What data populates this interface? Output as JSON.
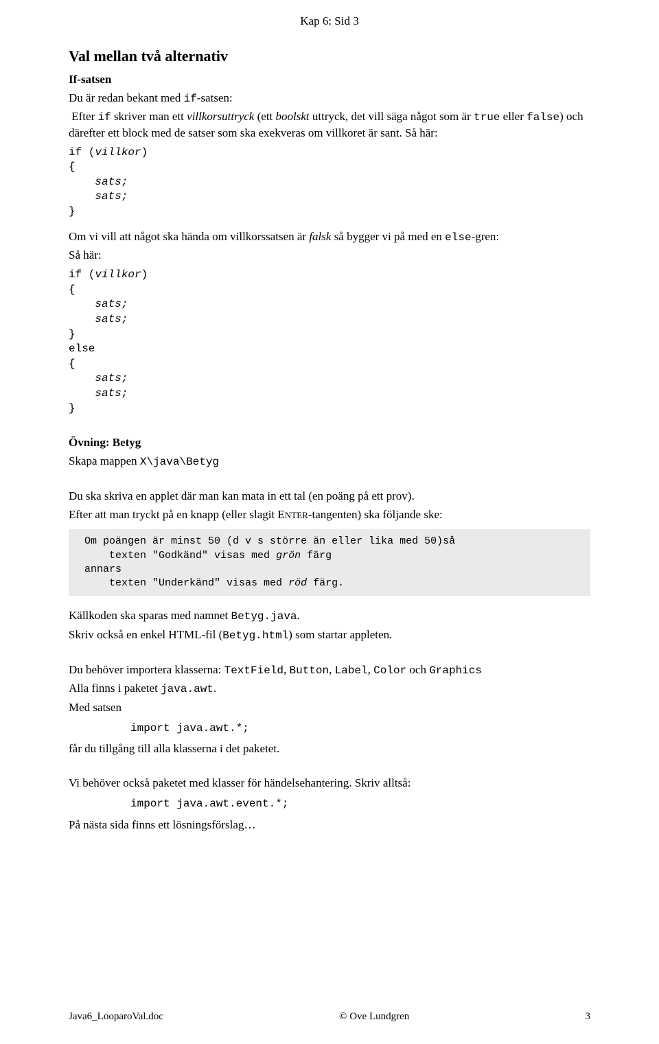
{
  "header": "Kap 6:  Sid 3",
  "title": "Val mellan två alternativ",
  "sub1": "If-satsen",
  "intro": {
    "pre_if": "Du  är redan bekant med ",
    "if_word": "if",
    "post_if": "-satsen:",
    "line2a": " Efter ",
    "line2_if": "if",
    "line2b": " skriver man ett ",
    "villkorsuttryck": "villkorsuttryck",
    "line2c": " (ett ",
    "boolskt": "boolskt",
    "line2d": " uttryck, det vill säga något som är ",
    "true": "true",
    "line2e": " eller ",
    "false": "false",
    "line2f": ") och därefter ett block med de satser som ska exekveras om villkoret är sant. Så här:"
  },
  "code1": "if (villkor)\n{\n    sats;\n    sats;\n}",
  "between": {
    "a": "Om vi vill att något ska hända om villkorssatsen är ",
    "falsk": "falsk",
    "b": " så bygger vi på med en ",
    "else": "else",
    "c": "-gren:",
    "d": "Så här:"
  },
  "code2": "if (villkor)\n{\n    sats;\n    sats;\n}\nelse\n{\n    sats;\n    sats;\n}",
  "ex_title": "Övning: Betyg",
  "ex_line1a": "Skapa mappen ",
  "ex_line1b": "X\\java\\Betyg",
  "ex_line2": "Du ska skriva en applet där man kan mata in ett tal (en poäng på ett prov).",
  "ex_line3a": "Efter att man tryckt på en knapp (eller slagit E",
  "ex_enter": "NTER",
  "ex_line3b": "-tangenten) ska följande ske:",
  "callout": " Om poängen är minst 50 (d v s större än eller lika med 50)så\n     texten \"Godkänd\" visas med grön färg\n annars\n     texten \"Underkänd\" visas med röd färg.",
  "save": {
    "a": "Källkoden ska sparas med namnet ",
    "b": "Betyg.java",
    "c": "."
  },
  "html_line": {
    "a": "Skriv också en enkel HTML-fil (",
    "b": "Betyg.html",
    "c": ") som startar appleten."
  },
  "import_line": {
    "a": "Du behöver importera klasserna: ",
    "c1": "TextField",
    "s": ", ",
    "c2": "Button",
    "c3": "Label",
    "c4": "Color",
    "och": " och ",
    "c5": "Graphics"
  },
  "pkg_line": {
    "a": "Alla finns i paketet ",
    "b": "java.awt",
    "c": "."
  },
  "med": "Med satsen",
  "import1": "import java.awt.*;",
  "after_import": "får du tillgång till alla klasserna i det paketet.",
  "event_line": "Vi behöver också paketet med klasser för händelsehantering. Skriv alltså:",
  "import2": "import java.awt.event.*;",
  "closing": "På nästa sida finns ett lösningsförslag…",
  "footer": {
    "left": "Java6_LooparoVal.doc",
    "center": "© Ove Lundgren",
    "right": "3"
  }
}
